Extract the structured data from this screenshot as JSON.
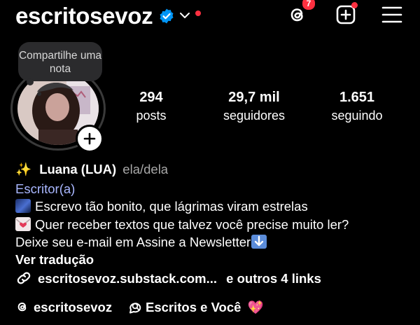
{
  "header": {
    "username": "escritosevoz",
    "threads_badge_count": "7",
    "icons": [
      "verified-badge-icon",
      "chevron-down-icon",
      "threads-icon",
      "create-post-icon",
      "menu-icon"
    ]
  },
  "note": {
    "text": "Compartilhe uma nota"
  },
  "stats": [
    {
      "value": "294",
      "label": "posts"
    },
    {
      "value": "29,7 mil",
      "label": "seguidores"
    },
    {
      "value": "1.651",
      "label": "seguindo"
    }
  ],
  "bio": {
    "name_emoji": "✨",
    "name": "Luana (LUA)",
    "pronouns": "ela/dela",
    "category": "Escritor(a)",
    "line1": "Escrevo tão bonito, que lágrimas viram estrelas",
    "line2": "Quer receber textos que talvez você precise muito ler?",
    "line3": "Deixe seu e-mail em Assine a Newsletter",
    "line3_emoji": "⬇️",
    "translate": "Ver tradução",
    "link": "escritosevoz.substack.com...",
    "more_links": "e outros 4 links"
  },
  "footer": {
    "threads_handle": "escritosevoz",
    "channel": "Escritos e Você",
    "channel_emoji": "💖"
  },
  "colors": {
    "background": "#000000",
    "verified": "#0095f6",
    "notification": "#ff3040",
    "category": "#a9b7ff"
  }
}
